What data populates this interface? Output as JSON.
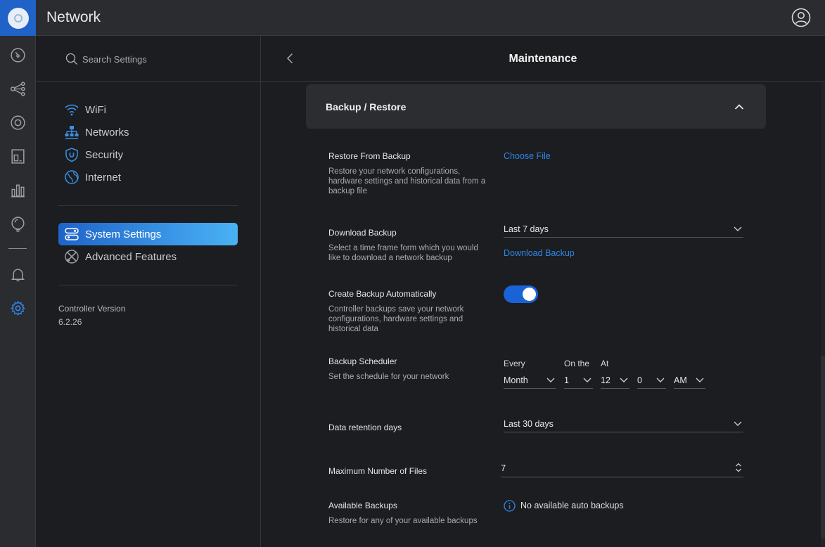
{
  "app": {
    "title": "Network"
  },
  "rail": {
    "icons": [
      "dashboard-icon",
      "topology-icon",
      "devices-icon",
      "clients-icon",
      "statistics-icon",
      "insights-icon",
      "notifications-icon",
      "settings-icon"
    ],
    "active_color": "#2f86e8"
  },
  "sidebar": {
    "search_placeholder": "Search Settings",
    "items": [
      {
        "label": "WiFi",
        "icon": "wifi-icon"
      },
      {
        "label": "Networks",
        "icon": "networks-icon"
      },
      {
        "label": "Security",
        "icon": "shield-icon"
      },
      {
        "label": "Internet",
        "icon": "globe-icon"
      }
    ],
    "items2": [
      {
        "label": "System Settings",
        "icon": "system-settings-icon",
        "active": true
      },
      {
        "label": "Advanced Features",
        "icon": "advanced-features-icon"
      }
    ],
    "controller_version_label": "Controller Version",
    "controller_version": "6.2.26"
  },
  "main": {
    "title": "Maintenance",
    "section": {
      "title": "Backup / Restore",
      "restore": {
        "title": "Restore From Backup",
        "desc": "Restore your network configurations, hardware settings and historical data from a backup file",
        "action": "Choose File"
      },
      "download": {
        "title": "Download Backup",
        "desc": "Select a time frame form which you would like to download a network backup",
        "timeframe": "Last 7 days",
        "action": "Download Backup"
      },
      "auto": {
        "title": "Create Backup Automatically",
        "desc": "Controller backups save your network configurations, hardware settings and historical data",
        "enabled": true
      },
      "scheduler": {
        "title": "Backup Scheduler",
        "desc": "Set the schedule for your network",
        "every_label": "Every",
        "on_the_label": "On the",
        "at_label": "At",
        "every": "Month",
        "on_the": "1",
        "hour": "12",
        "minute": "0",
        "ampm": "AM"
      },
      "retention": {
        "title": "Data retention days",
        "value": "Last 30 days"
      },
      "max_files": {
        "title": "Maximum Number of Files",
        "value": "7"
      },
      "available": {
        "title": "Available Backups",
        "desc": "Restore for any of your available backups",
        "status": "No available auto backups"
      }
    }
  }
}
